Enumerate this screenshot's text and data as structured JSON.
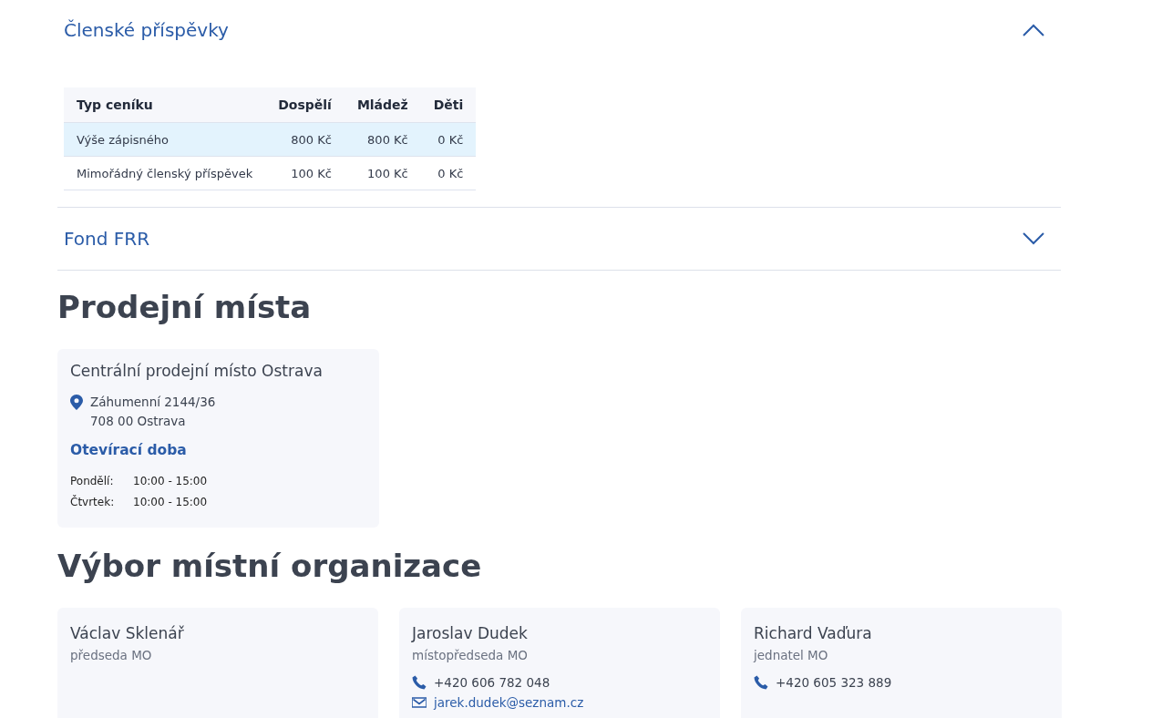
{
  "accordions": [
    {
      "title": "Členské příspěvky",
      "expanded": true,
      "table": {
        "columns": [
          "Typ ceníku",
          "Dospělí",
          "Mládež",
          "Děti"
        ],
        "rows": [
          {
            "cells": [
              "Výše zápisného",
              "800 Kč",
              "800 Kč",
              "0 Kč"
            ],
            "highlighted": true
          },
          {
            "cells": [
              "Mimořádný členský příspěvek",
              "100 Kč",
              "100 Kč",
              "0 Kč"
            ],
            "highlighted": false
          }
        ]
      }
    },
    {
      "title": "Fond FRR",
      "expanded": false
    }
  ],
  "sales_points": {
    "heading": "Prodejní místa",
    "items": [
      {
        "name": "Centrální prodejní místo Ostrava",
        "address": [
          "Záhumenní 2144/36",
          "708 00 Ostrava"
        ],
        "hours_title": "Otevírací doba",
        "hours": [
          {
            "day": "Pondělí:",
            "time": "10:00 - 15:00"
          },
          {
            "day": "Čtvrtek:",
            "time": "10:00 - 15:00"
          }
        ]
      }
    ]
  },
  "committee": {
    "heading": "Výbor místní organizace",
    "members": [
      {
        "name": "Václav Sklenář",
        "role": "předseda MO"
      },
      {
        "name": "Jaroslav Dudek",
        "role": "místopředseda MO",
        "phone": "+420 606 782 048",
        "email": "jarek.dudek@seznam.cz"
      },
      {
        "name": "Richard Vaďura",
        "role": "jednatel MO",
        "phone": "+420 605 323 889"
      }
    ]
  }
}
